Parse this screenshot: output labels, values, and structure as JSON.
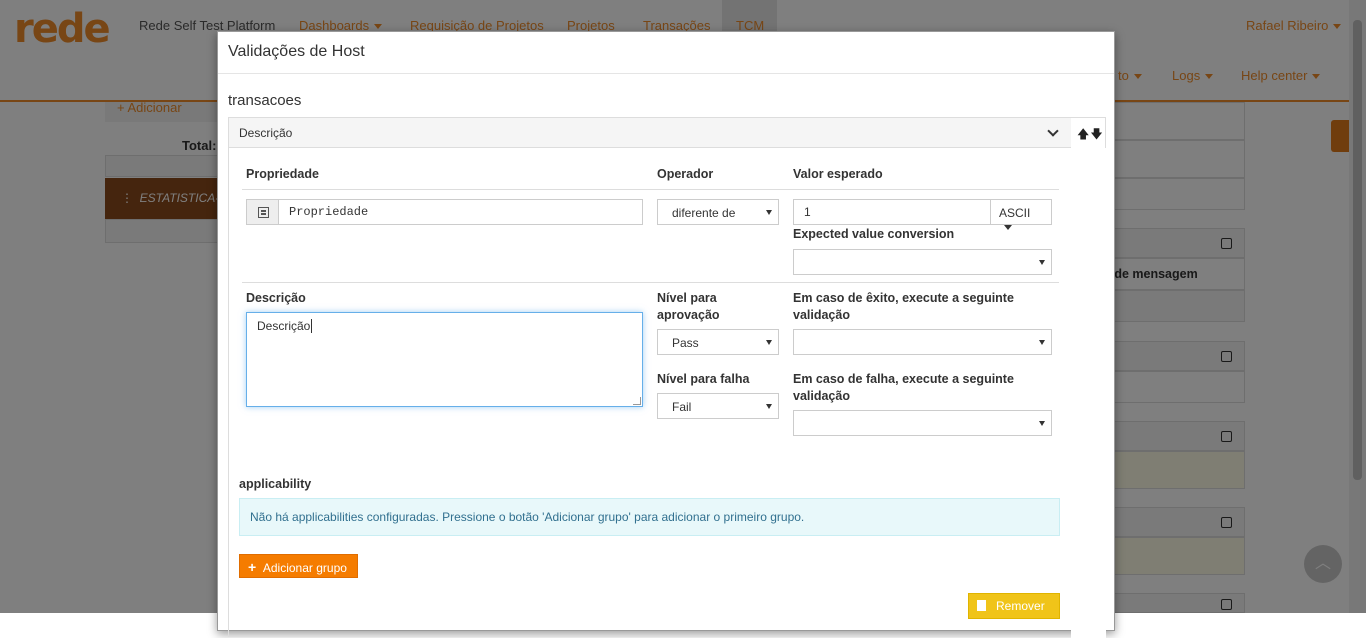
{
  "background": {
    "logo": "rede",
    "platform_name": "Rede Self Test Platform",
    "nav": [
      "Dashboards",
      "Requisição de Projetos",
      "Projetos",
      "Transações",
      "TCM"
    ],
    "user": "Rafael Ribeiro",
    "nav_secondary": [
      "to",
      "Logs",
      "Help center"
    ],
    "add_button": "+ Adicionar",
    "total_label": "Total:",
    "row_label": "ESTATISTICA-CI",
    "right_column_text": "r de mensagem"
  },
  "modal": {
    "title": "Validações de Host",
    "section_title": "transacoes",
    "panel_title": "Descrição",
    "arrows": "🡅🡇",
    "fields": {
      "propriedade_label": "Propriedade",
      "propriedade_value": "Propriedade",
      "operador_label": "Operador",
      "operador_value": "diferente de",
      "valor_label": "Valor esperado",
      "valor_value": "1",
      "encoding_button": "ASCII",
      "conversion_label": "Expected value conversion",
      "conversion_value": "",
      "descricao_label": "Descrição",
      "descricao_value": "Descrição",
      "nivel_aprovacao_label_1": "Nível para",
      "nivel_aprovacao_label_2": "aprovação",
      "nivel_aprovacao_value": "Pass",
      "nivel_falha_label": "Nível para falha",
      "nivel_falha_value": "Fail",
      "exito_label_1": "Em caso de êxito, execute a seguinte",
      "exito_label_2": "validação",
      "exito_value": "",
      "falha_label_1": "Em caso de falha, execute a seguinte",
      "falha_label_2": "validação",
      "falha_value": ""
    },
    "applicability_label": "applicability",
    "applicability_empty": "Não há applicabilities configuradas. Pressione o botão 'Adicionar grupo' para adicionar o primeiro grupo.",
    "add_group_button": "Adicionar grupo",
    "remove_button": "Remover"
  },
  "colors": {
    "brand_orange": "#f08c2a",
    "add_group_orange": "#f57c00",
    "remove_yellow": "#f0c419",
    "info_bg": "#e8f8fa"
  }
}
